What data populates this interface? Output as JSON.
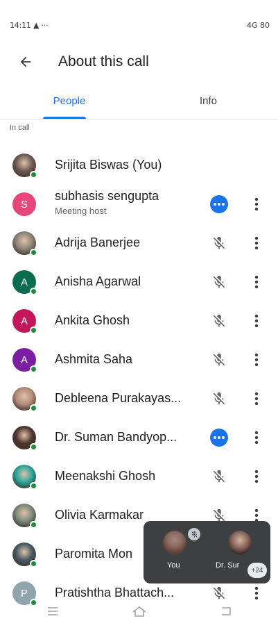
{
  "status_bar": {
    "left": "14:11 ▲ ···",
    "right": "4G 80"
  },
  "app_bar": {
    "title": "About this call"
  },
  "tabs": [
    {
      "label": "People"
    },
    {
      "label": "Info"
    }
  ],
  "section": {
    "in_call": "In call"
  },
  "participants": [
    {
      "name": "Srijita Biswas (You)",
      "status": "",
      "initial": "",
      "avatar_color": "#6d5a52",
      "action": "none"
    },
    {
      "name": "subhasis sengupta",
      "status": "Meeting host",
      "initial": "S",
      "avatar_color": "#e8457a",
      "action": "more-blue"
    },
    {
      "name": "Adrija Banerjee",
      "status": "",
      "initial": "",
      "avatar_color": "#8d8478",
      "action": "mic-off"
    },
    {
      "name": "Anisha Agarwal",
      "status": "",
      "initial": "A",
      "avatar_color": "#0b6b4f",
      "action": "mic-off"
    },
    {
      "name": "Ankita Ghosh",
      "status": "",
      "initial": "A",
      "avatar_color": "#c2185b",
      "action": "mic-off"
    },
    {
      "name": "Ashmita Saha",
      "status": "",
      "initial": "A",
      "avatar_color": "#7b1fa2",
      "action": "mic-off"
    },
    {
      "name": "Debleena Purakayas...",
      "status": "",
      "initial": "",
      "avatar_color": "#b38a7a",
      "action": "mic-off"
    },
    {
      "name": "Dr. Suman Bandyop...",
      "status": "",
      "initial": "",
      "avatar_color": "#4e342e",
      "action": "more-blue"
    },
    {
      "name": "Meenakshi Ghosh",
      "status": "",
      "initial": "",
      "avatar_color": "#26a69a",
      "action": "mic-off"
    },
    {
      "name": "Olivia Karmakar",
      "status": "",
      "initial": "",
      "avatar_color": "#7a8a7a",
      "action": "mic-off"
    },
    {
      "name": "Paromita Mon",
      "status": "",
      "initial": "",
      "avatar_color": "#455a64",
      "action": "mic-off"
    },
    {
      "name": "Pratishtha Bhattach...",
      "status": "",
      "initial": "P",
      "avatar_color": "#90a4ae",
      "action": "mic-off"
    }
  ],
  "pip": {
    "you_label": "You",
    "other_label": "Dr. Sur",
    "count": "+24"
  },
  "colors": {
    "accent": "#1a73e8",
    "online": "#1e8e3e"
  },
  "icons": {
    "back": "arrow-back-icon",
    "mic_off": "mic-off-icon",
    "more": "more-vertical-icon",
    "nav_menu": "menu-icon",
    "nav_home": "home-icon",
    "nav_back": "back-nav-icon"
  }
}
